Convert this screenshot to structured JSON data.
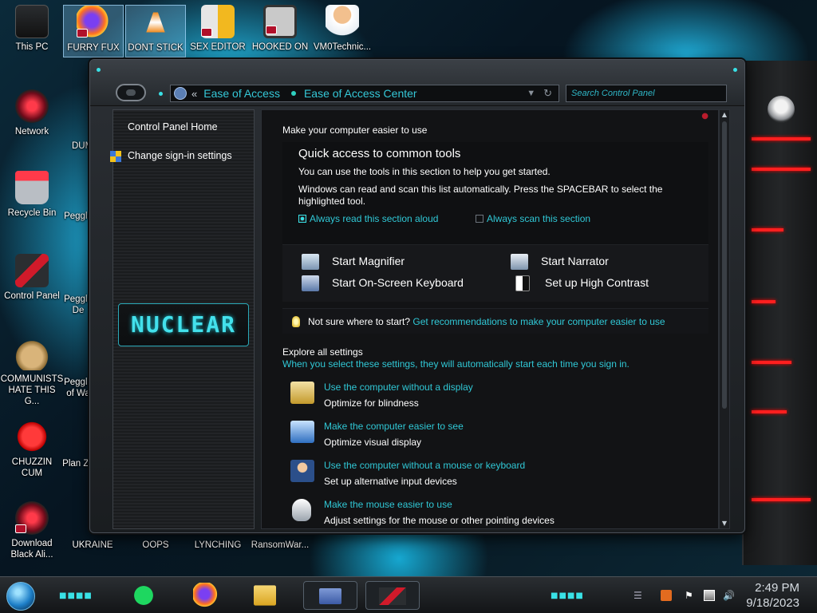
{
  "desktop": {
    "icons": [
      {
        "label": "This PC"
      },
      {
        "label": "FURRY FUX"
      },
      {
        "label": "DONT STICK"
      },
      {
        "label": "SEX EDITOR"
      },
      {
        "label": "HOOKED ON"
      },
      {
        "label": "VM0Technic..."
      },
      {
        "label": "Network"
      },
      {
        "label": "Recycle Bin"
      },
      {
        "label": "Control Panel"
      },
      {
        "label": "COMMUNISTS HATE THIS G..."
      },
      {
        "label": "CHUZZIN CUM"
      },
      {
        "label": "Download Black Ali..."
      },
      {
        "label": "UKRAINE"
      },
      {
        "label": "OOPS"
      },
      {
        "label": "LYNCHING"
      },
      {
        "label": "RansomWar..."
      },
      {
        "label": "DUM"
      },
      {
        "label": "Peggle"
      },
      {
        "label": "Peggle De"
      },
      {
        "label": "Peggle of Wa"
      },
      {
        "label": "Plan Zo"
      }
    ]
  },
  "window": {
    "breadcrumb": [
      "Ease of Access",
      "Ease of Access Center"
    ],
    "breadcrumb_prefix": "«",
    "search_placeholder": "Search Control Panel",
    "sidebar": {
      "home": "Control Panel Home",
      "signin": "Change sign-in settings",
      "logo": "NUCLEAR"
    },
    "main": {
      "heading": "Make your computer easier to use",
      "qa_title": "Quick access to common tools",
      "qa_desc1": "You can use the tools in this section to help you get started.",
      "qa_desc2": "Windows can read and scan this list automatically.  Press the SPACEBAR to select the highlighted tool.",
      "opt_read_aloud": "Always read this section aloud",
      "opt_read_aloud_checked": true,
      "opt_scan": "Always scan this section",
      "opt_scan_checked": false,
      "tools": {
        "magnifier": "Start Magnifier",
        "narrator": "Start Narrator",
        "keyboard": "Start On-Screen Keyboard",
        "contrast": "Set up High Contrast"
      },
      "not_sure": "Not sure where to start?",
      "recommend_link": "Get recommendations to make your computer easier to use",
      "explore_title": "Explore all settings",
      "explore_desc": "When you select these settings, they will automatically start each time you sign in.",
      "settings": [
        {
          "link": "Use the computer without a display",
          "desc": "Optimize for blindness"
        },
        {
          "link": "Make the computer easier to see",
          "desc": "Optimize visual display"
        },
        {
          "link": "Use the computer without a mouse or keyboard",
          "desc": "Set up alternative input devices"
        },
        {
          "link": "Make the mouse easier to use",
          "desc": "Adjust settings for the mouse or other pointing devices"
        }
      ]
    }
  },
  "taskbar": {
    "time": "2:49 PM",
    "date": "9/18/2023"
  },
  "colors": {
    "accent": "#30c8d6",
    "window_bg": "#121315"
  }
}
